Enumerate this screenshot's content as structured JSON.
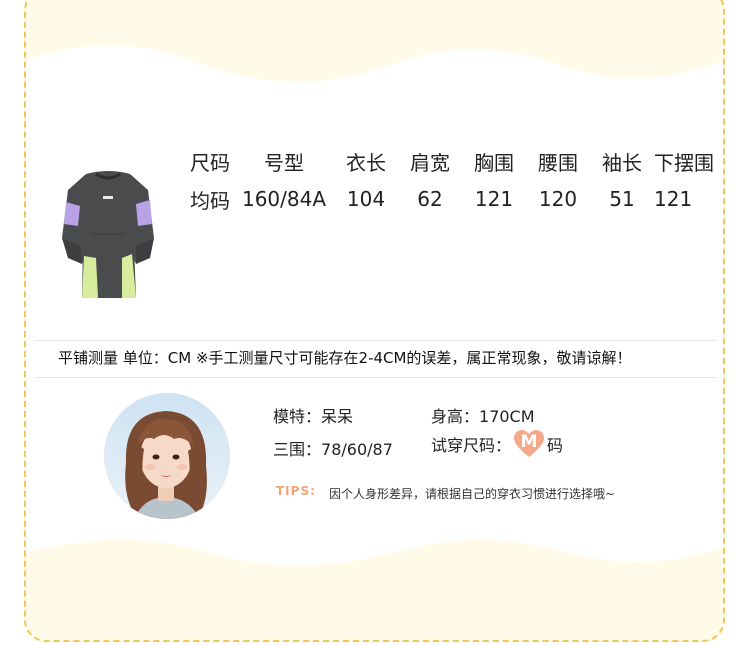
{
  "size_table": {
    "headers": [
      "尺码",
      "号型",
      "衣长",
      "肩宽",
      "胸围",
      "腰围",
      "袖长",
      "下摆围"
    ],
    "row": [
      "均码",
      "160/84A",
      "104",
      "62",
      "121",
      "120",
      "51",
      "121"
    ]
  },
  "note": "平铺测量 单位：CM ※手工测量尺寸可能存在2-4CM的误差，属正常现象，敬请谅解！",
  "model": {
    "name_label": "模特：",
    "name_value": "呆呆",
    "height_label": "身高：",
    "height_value": "170CM",
    "measure_label": "三围：",
    "measure_value": "78/60/87",
    "size_label": "试穿尺码：",
    "size_value": "M",
    "size_suffix": "码"
  },
  "tips": {
    "label": "TIPS:",
    "text": "因个人身形差异，请根据自己的穿衣习惯进行选择哦~"
  },
  "colors": {
    "card_bg": "#fffbe8",
    "dashed_border": "#f0c75a",
    "heart": "#f6a88a",
    "tips": "#f2a378",
    "garment_body": "#4a4b4d",
    "garment_purple": "#b9a3e6",
    "garment_green": "#d7ec9c"
  }
}
